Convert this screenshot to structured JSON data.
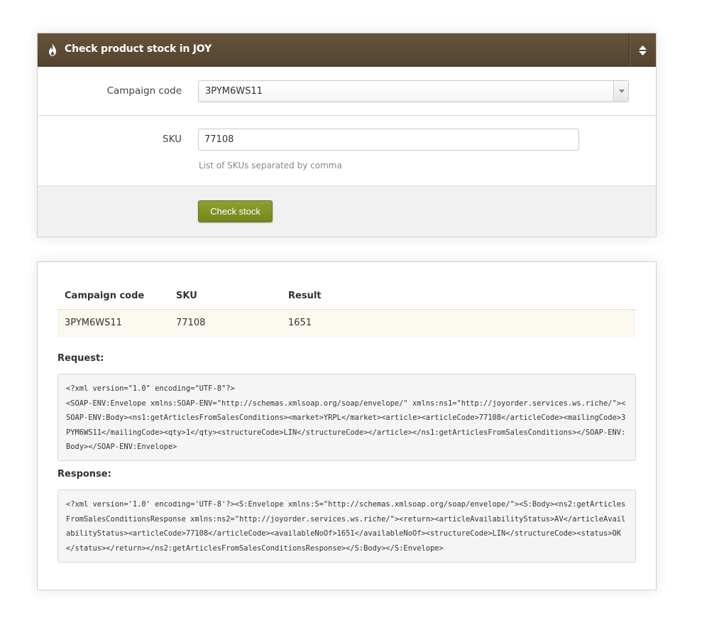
{
  "form": {
    "title": "Check product stock in JOY",
    "campaign_label": "Campaign code",
    "campaign_value": "3PYM6WS11",
    "sku_label": "SKU",
    "sku_value": "77108",
    "sku_hint": "List of SKUs separated by comma",
    "submit_label": "Check stock"
  },
  "results": {
    "columns": [
      "Campaign code",
      "SKU",
      "Result"
    ],
    "rows": [
      [
        "3PYM6WS11",
        "77108",
        "1651"
      ]
    ]
  },
  "request": {
    "label": "Request:",
    "body": "<?xml version=\"1.0\" encoding=\"UTF-8\"?>\n<SOAP-ENV:Envelope xmlns:SOAP-ENV=\"http://schemas.xmlsoap.org/soap/envelope/\" xmlns:ns1=\"http://joyorder.services.ws.riche/\"><SOAP-ENV:Body><ns1:getArticlesFromSalesConditions><market>YRPL</market><article><articleCode>77108</articleCode><mailingCode>3PYM6WS11</mailingCode><qty>1</qty><structureCode>LIN</structureCode></article></ns1:getArticlesFromSalesConditions></SOAP-ENV:Body></SOAP-ENV:Envelope>"
  },
  "response": {
    "label": "Response:",
    "body": "<?xml version='1.0' encoding='UTF-8'?><S:Envelope xmlns:S=\"http://schemas.xmlsoap.org/soap/envelope/\"><S:Body><ns2:getArticlesFromSalesConditionsResponse xmlns:ns2=\"http://joyorder.services.ws.riche/\"><return><articleAvailabilityStatus>AV</articleAvailabilityStatus><articleCode>77108</articleCode><availableNoOf>1651</availableNoOf><structureCode>LIN</structureCode><status>OK</status></return></ns2:getArticlesFromSalesConditionsResponse></S:Body></S:Envelope>"
  },
  "colors": {
    "header_bg": "#5a4a35",
    "button_bg": "#7f9326",
    "result_row_bg": "#fbf8f0"
  },
  "icons": {
    "header": "flame-icon",
    "toggle": "sort-toggle-icon",
    "select_arrow": "chevron-down-icon"
  }
}
